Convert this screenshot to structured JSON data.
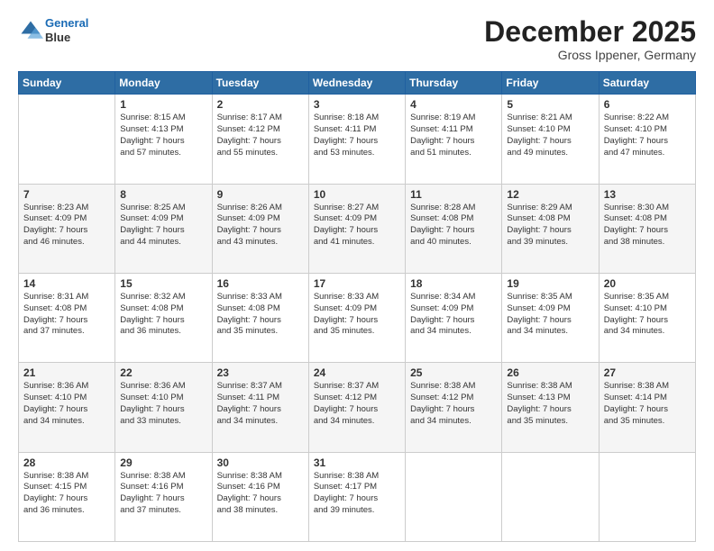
{
  "header": {
    "logo_line1": "General",
    "logo_line2": "Blue",
    "month": "December 2025",
    "location": "Gross Ippener, Germany"
  },
  "weekdays": [
    "Sunday",
    "Monday",
    "Tuesday",
    "Wednesday",
    "Thursday",
    "Friday",
    "Saturday"
  ],
  "weeks": [
    [
      {
        "day": "",
        "info": ""
      },
      {
        "day": "1",
        "info": "Sunrise: 8:15 AM\nSunset: 4:13 PM\nDaylight: 7 hours\nand 57 minutes."
      },
      {
        "day": "2",
        "info": "Sunrise: 8:17 AM\nSunset: 4:12 PM\nDaylight: 7 hours\nand 55 minutes."
      },
      {
        "day": "3",
        "info": "Sunrise: 8:18 AM\nSunset: 4:11 PM\nDaylight: 7 hours\nand 53 minutes."
      },
      {
        "day": "4",
        "info": "Sunrise: 8:19 AM\nSunset: 4:11 PM\nDaylight: 7 hours\nand 51 minutes."
      },
      {
        "day": "5",
        "info": "Sunrise: 8:21 AM\nSunset: 4:10 PM\nDaylight: 7 hours\nand 49 minutes."
      },
      {
        "day": "6",
        "info": "Sunrise: 8:22 AM\nSunset: 4:10 PM\nDaylight: 7 hours\nand 47 minutes."
      }
    ],
    [
      {
        "day": "7",
        "info": "Sunrise: 8:23 AM\nSunset: 4:09 PM\nDaylight: 7 hours\nand 46 minutes."
      },
      {
        "day": "8",
        "info": "Sunrise: 8:25 AM\nSunset: 4:09 PM\nDaylight: 7 hours\nand 44 minutes."
      },
      {
        "day": "9",
        "info": "Sunrise: 8:26 AM\nSunset: 4:09 PM\nDaylight: 7 hours\nand 43 minutes."
      },
      {
        "day": "10",
        "info": "Sunrise: 8:27 AM\nSunset: 4:09 PM\nDaylight: 7 hours\nand 41 minutes."
      },
      {
        "day": "11",
        "info": "Sunrise: 8:28 AM\nSunset: 4:08 PM\nDaylight: 7 hours\nand 40 minutes."
      },
      {
        "day": "12",
        "info": "Sunrise: 8:29 AM\nSunset: 4:08 PM\nDaylight: 7 hours\nand 39 minutes."
      },
      {
        "day": "13",
        "info": "Sunrise: 8:30 AM\nSunset: 4:08 PM\nDaylight: 7 hours\nand 38 minutes."
      }
    ],
    [
      {
        "day": "14",
        "info": "Sunrise: 8:31 AM\nSunset: 4:08 PM\nDaylight: 7 hours\nand 37 minutes."
      },
      {
        "day": "15",
        "info": "Sunrise: 8:32 AM\nSunset: 4:08 PM\nDaylight: 7 hours\nand 36 minutes."
      },
      {
        "day": "16",
        "info": "Sunrise: 8:33 AM\nSunset: 4:08 PM\nDaylight: 7 hours\nand 35 minutes."
      },
      {
        "day": "17",
        "info": "Sunrise: 8:33 AM\nSunset: 4:09 PM\nDaylight: 7 hours\nand 35 minutes."
      },
      {
        "day": "18",
        "info": "Sunrise: 8:34 AM\nSunset: 4:09 PM\nDaylight: 7 hours\nand 34 minutes."
      },
      {
        "day": "19",
        "info": "Sunrise: 8:35 AM\nSunset: 4:09 PM\nDaylight: 7 hours\nand 34 minutes."
      },
      {
        "day": "20",
        "info": "Sunrise: 8:35 AM\nSunset: 4:10 PM\nDaylight: 7 hours\nand 34 minutes."
      }
    ],
    [
      {
        "day": "21",
        "info": "Sunrise: 8:36 AM\nSunset: 4:10 PM\nDaylight: 7 hours\nand 34 minutes."
      },
      {
        "day": "22",
        "info": "Sunrise: 8:36 AM\nSunset: 4:10 PM\nDaylight: 7 hours\nand 33 minutes."
      },
      {
        "day": "23",
        "info": "Sunrise: 8:37 AM\nSunset: 4:11 PM\nDaylight: 7 hours\nand 34 minutes."
      },
      {
        "day": "24",
        "info": "Sunrise: 8:37 AM\nSunset: 4:12 PM\nDaylight: 7 hours\nand 34 minutes."
      },
      {
        "day": "25",
        "info": "Sunrise: 8:38 AM\nSunset: 4:12 PM\nDaylight: 7 hours\nand 34 minutes."
      },
      {
        "day": "26",
        "info": "Sunrise: 8:38 AM\nSunset: 4:13 PM\nDaylight: 7 hours\nand 35 minutes."
      },
      {
        "day": "27",
        "info": "Sunrise: 8:38 AM\nSunset: 4:14 PM\nDaylight: 7 hours\nand 35 minutes."
      }
    ],
    [
      {
        "day": "28",
        "info": "Sunrise: 8:38 AM\nSunset: 4:15 PM\nDaylight: 7 hours\nand 36 minutes."
      },
      {
        "day": "29",
        "info": "Sunrise: 8:38 AM\nSunset: 4:16 PM\nDaylight: 7 hours\nand 37 minutes."
      },
      {
        "day": "30",
        "info": "Sunrise: 8:38 AM\nSunset: 4:16 PM\nDaylight: 7 hours\nand 38 minutes."
      },
      {
        "day": "31",
        "info": "Sunrise: 8:38 AM\nSunset: 4:17 PM\nDaylight: 7 hours\nand 39 minutes."
      },
      {
        "day": "",
        "info": ""
      },
      {
        "day": "",
        "info": ""
      },
      {
        "day": "",
        "info": ""
      }
    ]
  ]
}
